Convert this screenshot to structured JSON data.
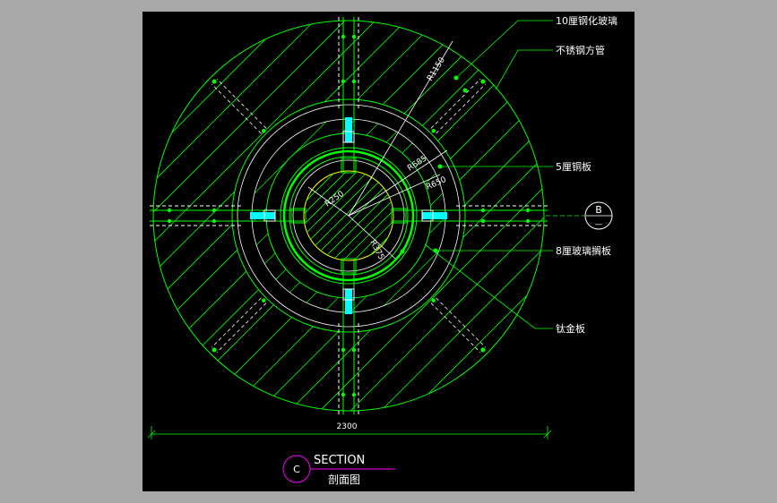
{
  "colors": {
    "background": "#a8a8a8",
    "canvas": "#000000",
    "line": "#00ff00",
    "text": "#ffffff",
    "dashed": "#ffffff",
    "axis": "#00ff00",
    "accent": "#ff00ff",
    "cyan": "#00ffff",
    "yellow": "#ffff00"
  },
  "callouts": {
    "glass_10": "10厘钢化玻璃",
    "stainless_tube": "不锈钢方管",
    "copper_5": "5厘铜板",
    "glass_8": "8厘玻璃搁板",
    "titanium": "钛金板"
  },
  "radii": {
    "r1150": "R1150",
    "r685": "R685",
    "r650": "R650",
    "r250": "R250",
    "r375": "R375"
  },
  "dimension": {
    "width": "2300"
  },
  "section_marker": {
    "letter": "C",
    "title": "SECTION",
    "subtitle": "剖面图"
  },
  "ref_marker": {
    "letter": "B",
    "dash": "—"
  }
}
